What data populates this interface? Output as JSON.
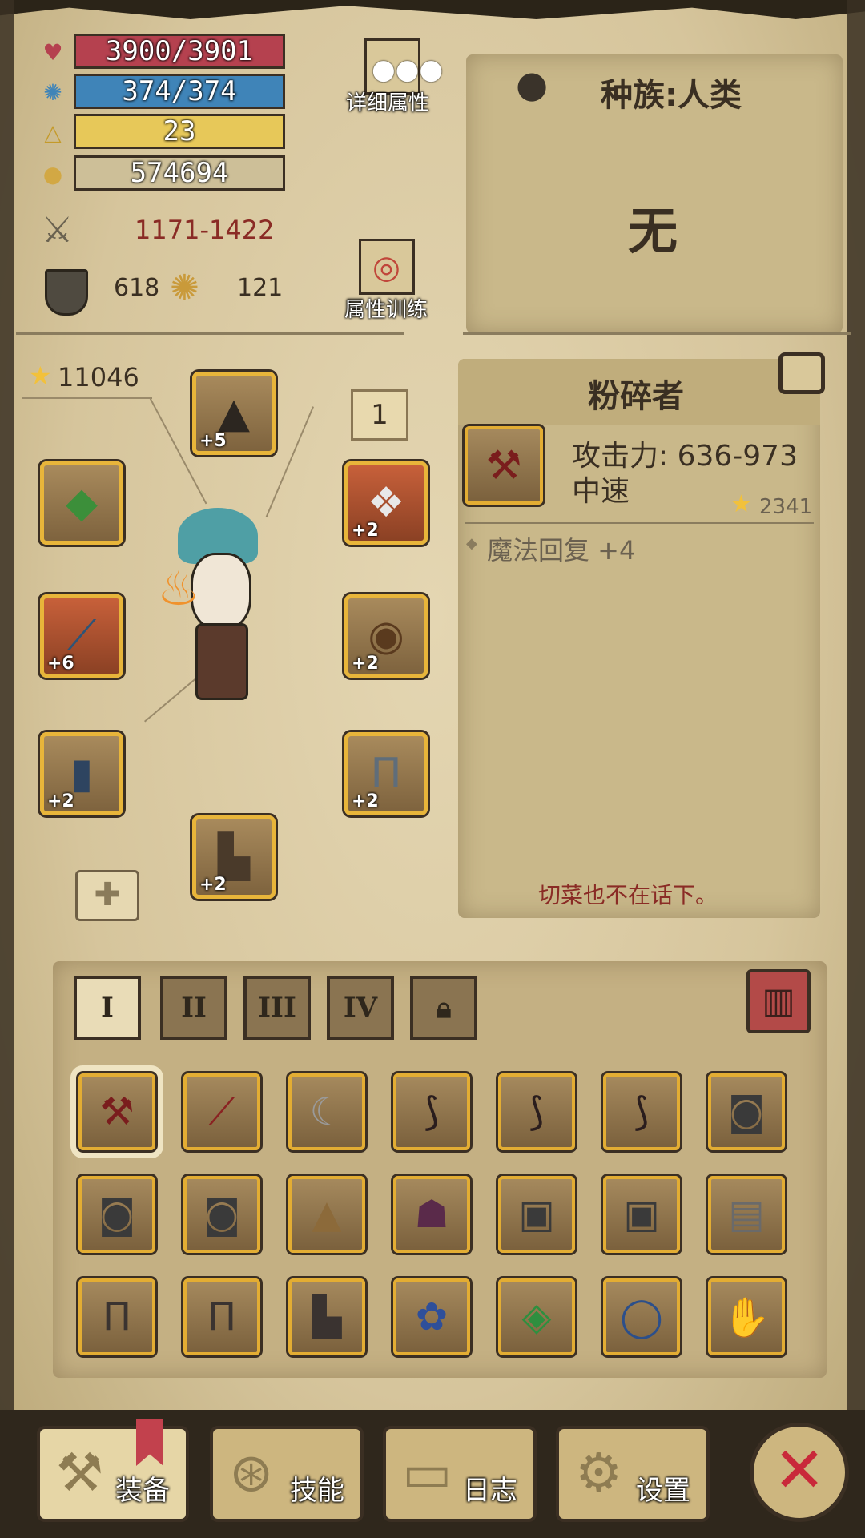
{
  "stats": {
    "hp": "3900/3901",
    "mp": "374/374",
    "level": "23",
    "gold": "574694",
    "attack": "1171-1422",
    "defense": "618",
    "magic": "121",
    "hp_fill": 1.0,
    "mp_fill": 1.0
  },
  "buttons": {
    "details": "详细属性",
    "training": "属性训练"
  },
  "race": {
    "label": "种族:人类",
    "value": "无"
  },
  "power_score": "11046",
  "equip_count": "1",
  "item": {
    "name": "粉碎者",
    "attack": "攻击力: 636-973",
    "speed": "中速",
    "score": "2341",
    "bonus": "魔法回复 +4",
    "flavor": "切菜也不在话下。"
  },
  "equipment_slots": [
    {
      "slot": "helmet",
      "plus": "+5",
      "icon": "straw-hat"
    },
    {
      "slot": "bracelet",
      "plus": "",
      "icon": "gem-bracelet"
    },
    {
      "slot": "amulet",
      "plus": "+2",
      "icon": "silver-amulet"
    },
    {
      "slot": "weapon",
      "plus": "+6",
      "icon": "blue-sword"
    },
    {
      "slot": "armor",
      "plus": "+2",
      "icon": "bead-armor"
    },
    {
      "slot": "gloves",
      "plus": "+2",
      "icon": "blue-gauntlet"
    },
    {
      "slot": "pants",
      "plus": "+2",
      "icon": "grey-pants"
    },
    {
      "slot": "boots",
      "plus": "+2",
      "icon": "boots"
    }
  ],
  "tabs": [
    "I",
    "II",
    "III",
    "IV"
  ],
  "inventory": [
    "crusher-axe",
    "red-scimitar",
    "curved-blade",
    "thorn-scythe",
    "thorn-scythe",
    "thorn-scythe",
    "iron-helmet",
    "iron-helmet",
    "iron-helmet",
    "straw-hat",
    "demon-mask",
    "iron-chestplate",
    "iron-chestplate",
    "plated-armor",
    "iron-greaves",
    "iron-greaves",
    "iron-boots",
    "peacock-bracelet",
    "jade-amulet",
    "gold-ring",
    "iron-gauntlet"
  ],
  "nav": [
    "装备",
    "技能",
    "日志",
    "设置"
  ],
  "colors": {
    "hp": "#b5414f",
    "mp": "#3f84b8",
    "xp": "#e7c859",
    "slot_border": "#e8b53a"
  }
}
